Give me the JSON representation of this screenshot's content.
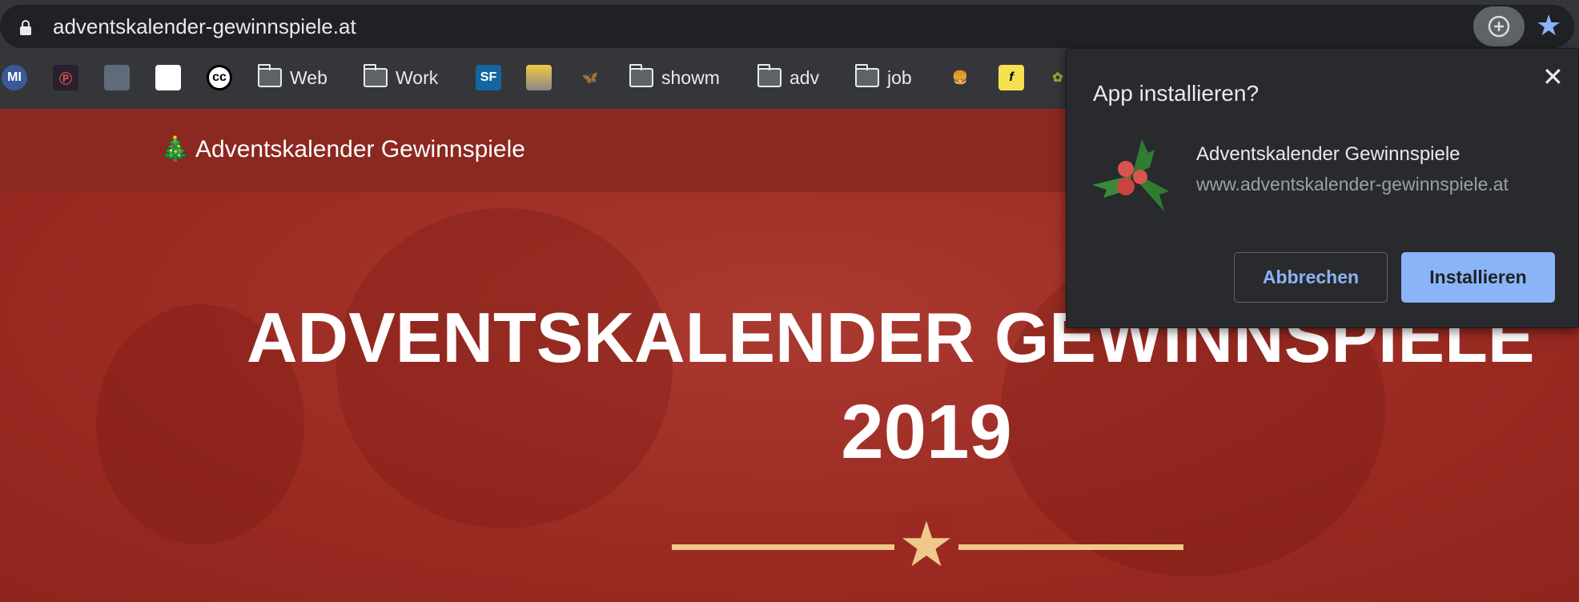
{
  "browser": {
    "url": "adventskalender-gewinnspiele.at",
    "accent": "#8ab4f8",
    "bookmarks": [
      {
        "type": "icon",
        "icon": "mi-icon",
        "label": "MI"
      },
      {
        "type": "icon",
        "icon": "mp-icon",
        "label": "Ⓟ"
      },
      {
        "type": "icon",
        "icon": "monitor-icon",
        "label": ""
      },
      {
        "type": "icon",
        "icon": "red-drop-icon",
        "label": ""
      },
      {
        "type": "icon",
        "icon": "creative-commons-icon",
        "label": "cc"
      },
      {
        "type": "folder",
        "label": "Web"
      },
      {
        "type": "folder",
        "label": "Work"
      },
      {
        "type": "icon",
        "icon": "sf-icon",
        "label": "SF"
      },
      {
        "type": "icon",
        "icon": "printer-icon",
        "label": ""
      },
      {
        "type": "icon",
        "icon": "butterfly-icon",
        "label": "🦋"
      },
      {
        "type": "folder",
        "label": "showm"
      },
      {
        "type": "folder",
        "label": "adv"
      },
      {
        "type": "folder",
        "label": "job"
      },
      {
        "type": "icon",
        "icon": "burger-icon",
        "label": "🍔"
      },
      {
        "type": "icon",
        "icon": "f-icon",
        "label": "f"
      },
      {
        "type": "icon",
        "icon": "leaf-icon",
        "label": "✿"
      }
    ]
  },
  "site": {
    "header_title": "🎄 Adventskalender Gewinnspiele",
    "hero_title": "ADVENTSKALENDER GEWINNSPIELE",
    "hero_year": "2019",
    "colors": {
      "header": "#8b2820",
      "hero": "#a3302a",
      "ornament": "#f0c98a"
    }
  },
  "install_dialog": {
    "title": "App installieren?",
    "app_name": "Adventskalender Gewinnspiele",
    "app_url": "www.adventskalender-gewinnspiele.at",
    "cancel_label": "Abbrechen",
    "install_label": "Installieren",
    "close_label": "✕"
  }
}
